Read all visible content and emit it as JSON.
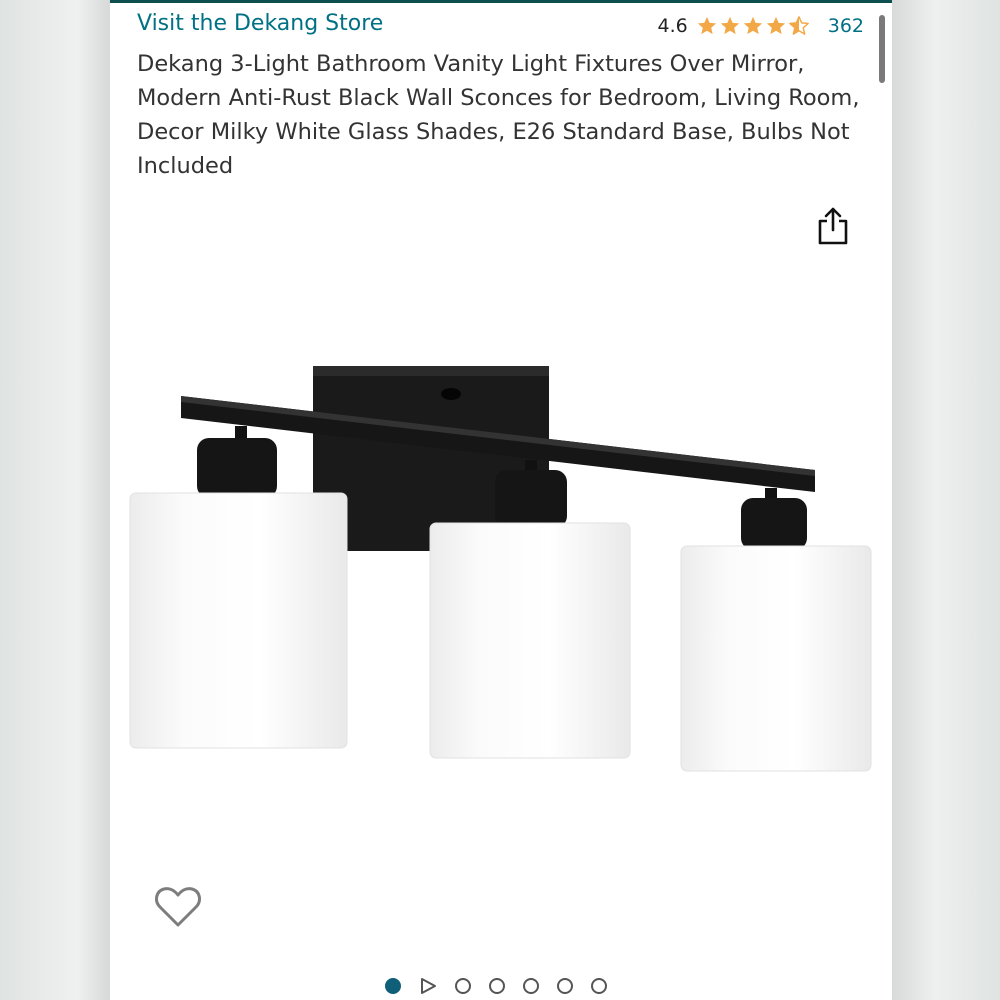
{
  "store": {
    "link_text": "Visit the Dekang Store"
  },
  "rating": {
    "value": "4.6",
    "stars_out_of_5": 4.5,
    "review_count": "362",
    "star_color": "#f3a847"
  },
  "product": {
    "title": "Dekang 3-Light Bathroom Vanity Light Fixtures Over Mirror, Modern Anti-Rust Black Wall Sconces for Bedroom, Living Room, Decor Milky White Glass Shades, E26 Standard Base, Bulbs Not Included"
  },
  "icons": {
    "share": "share-icon",
    "wishlist": "heart-outline-icon",
    "video": "play-triangle-icon"
  },
  "gallery": {
    "total_items": 7,
    "active_index": 0,
    "active_color": "#0f5f79"
  },
  "colors": {
    "link": "#007185",
    "accent_bar": "#0d4e4e"
  }
}
